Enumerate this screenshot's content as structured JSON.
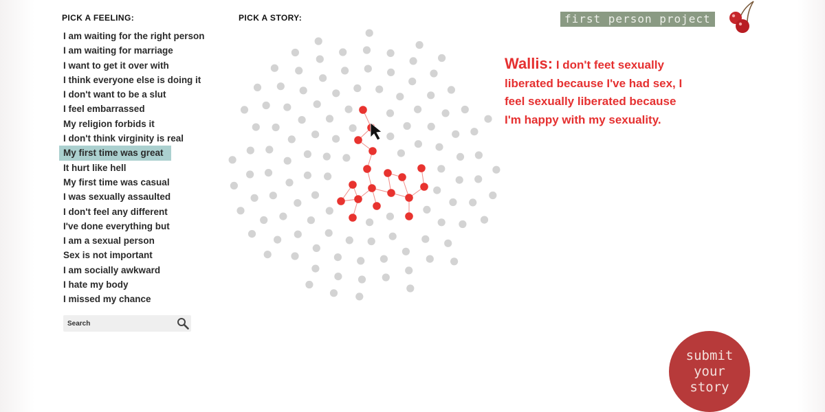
{
  "feelings_panel": {
    "heading": "PICK A FEELING:",
    "items": [
      {
        "label": "I am waiting for the right person"
      },
      {
        "label": "I am waiting for marriage"
      },
      {
        "label": "I want to get it over with"
      },
      {
        "label": "I think everyone else is doing it"
      },
      {
        "label": "I don't want to be a slut"
      },
      {
        "label": "I feel embarrassed"
      },
      {
        "label": "My religion forbids it"
      },
      {
        "label": "I don't think virginity is real"
      },
      {
        "label": "My first time was great",
        "selected": true
      },
      {
        "label": "It hurt like hell"
      },
      {
        "label": "My first time was casual"
      },
      {
        "label": "I was sexually assaulted"
      },
      {
        "label": "I don't feel any different"
      },
      {
        "label": "I've done everything but"
      },
      {
        "label": "I am a sexual person"
      },
      {
        "label": "Sex is not important"
      },
      {
        "label": "I am socially awkward"
      },
      {
        "label": "I hate my body"
      },
      {
        "label": "I missed my chance"
      }
    ],
    "selected_color": "#abd0cf"
  },
  "search": {
    "placeholder": "Search",
    "value": "",
    "icon": "magnifier-icon"
  },
  "story_panel": {
    "heading": "PICK A STORY:",
    "dot_color": "#d3d3d3",
    "highlight_color": "#e8332f"
  },
  "logo": {
    "text": "first person project",
    "icon": "cherries-icon",
    "bg_color": "#8a9a83"
  },
  "story": {
    "author": "Wallis:",
    "quote": "I don't feet sexually liberated because I've had sex, I feel sexually liberated because I'm happy with my sexuality.",
    "color": "#e53030"
  },
  "submit_button": {
    "lines": [
      "submit",
      "your",
      "story"
    ],
    "color": "#b73a3a"
  }
}
